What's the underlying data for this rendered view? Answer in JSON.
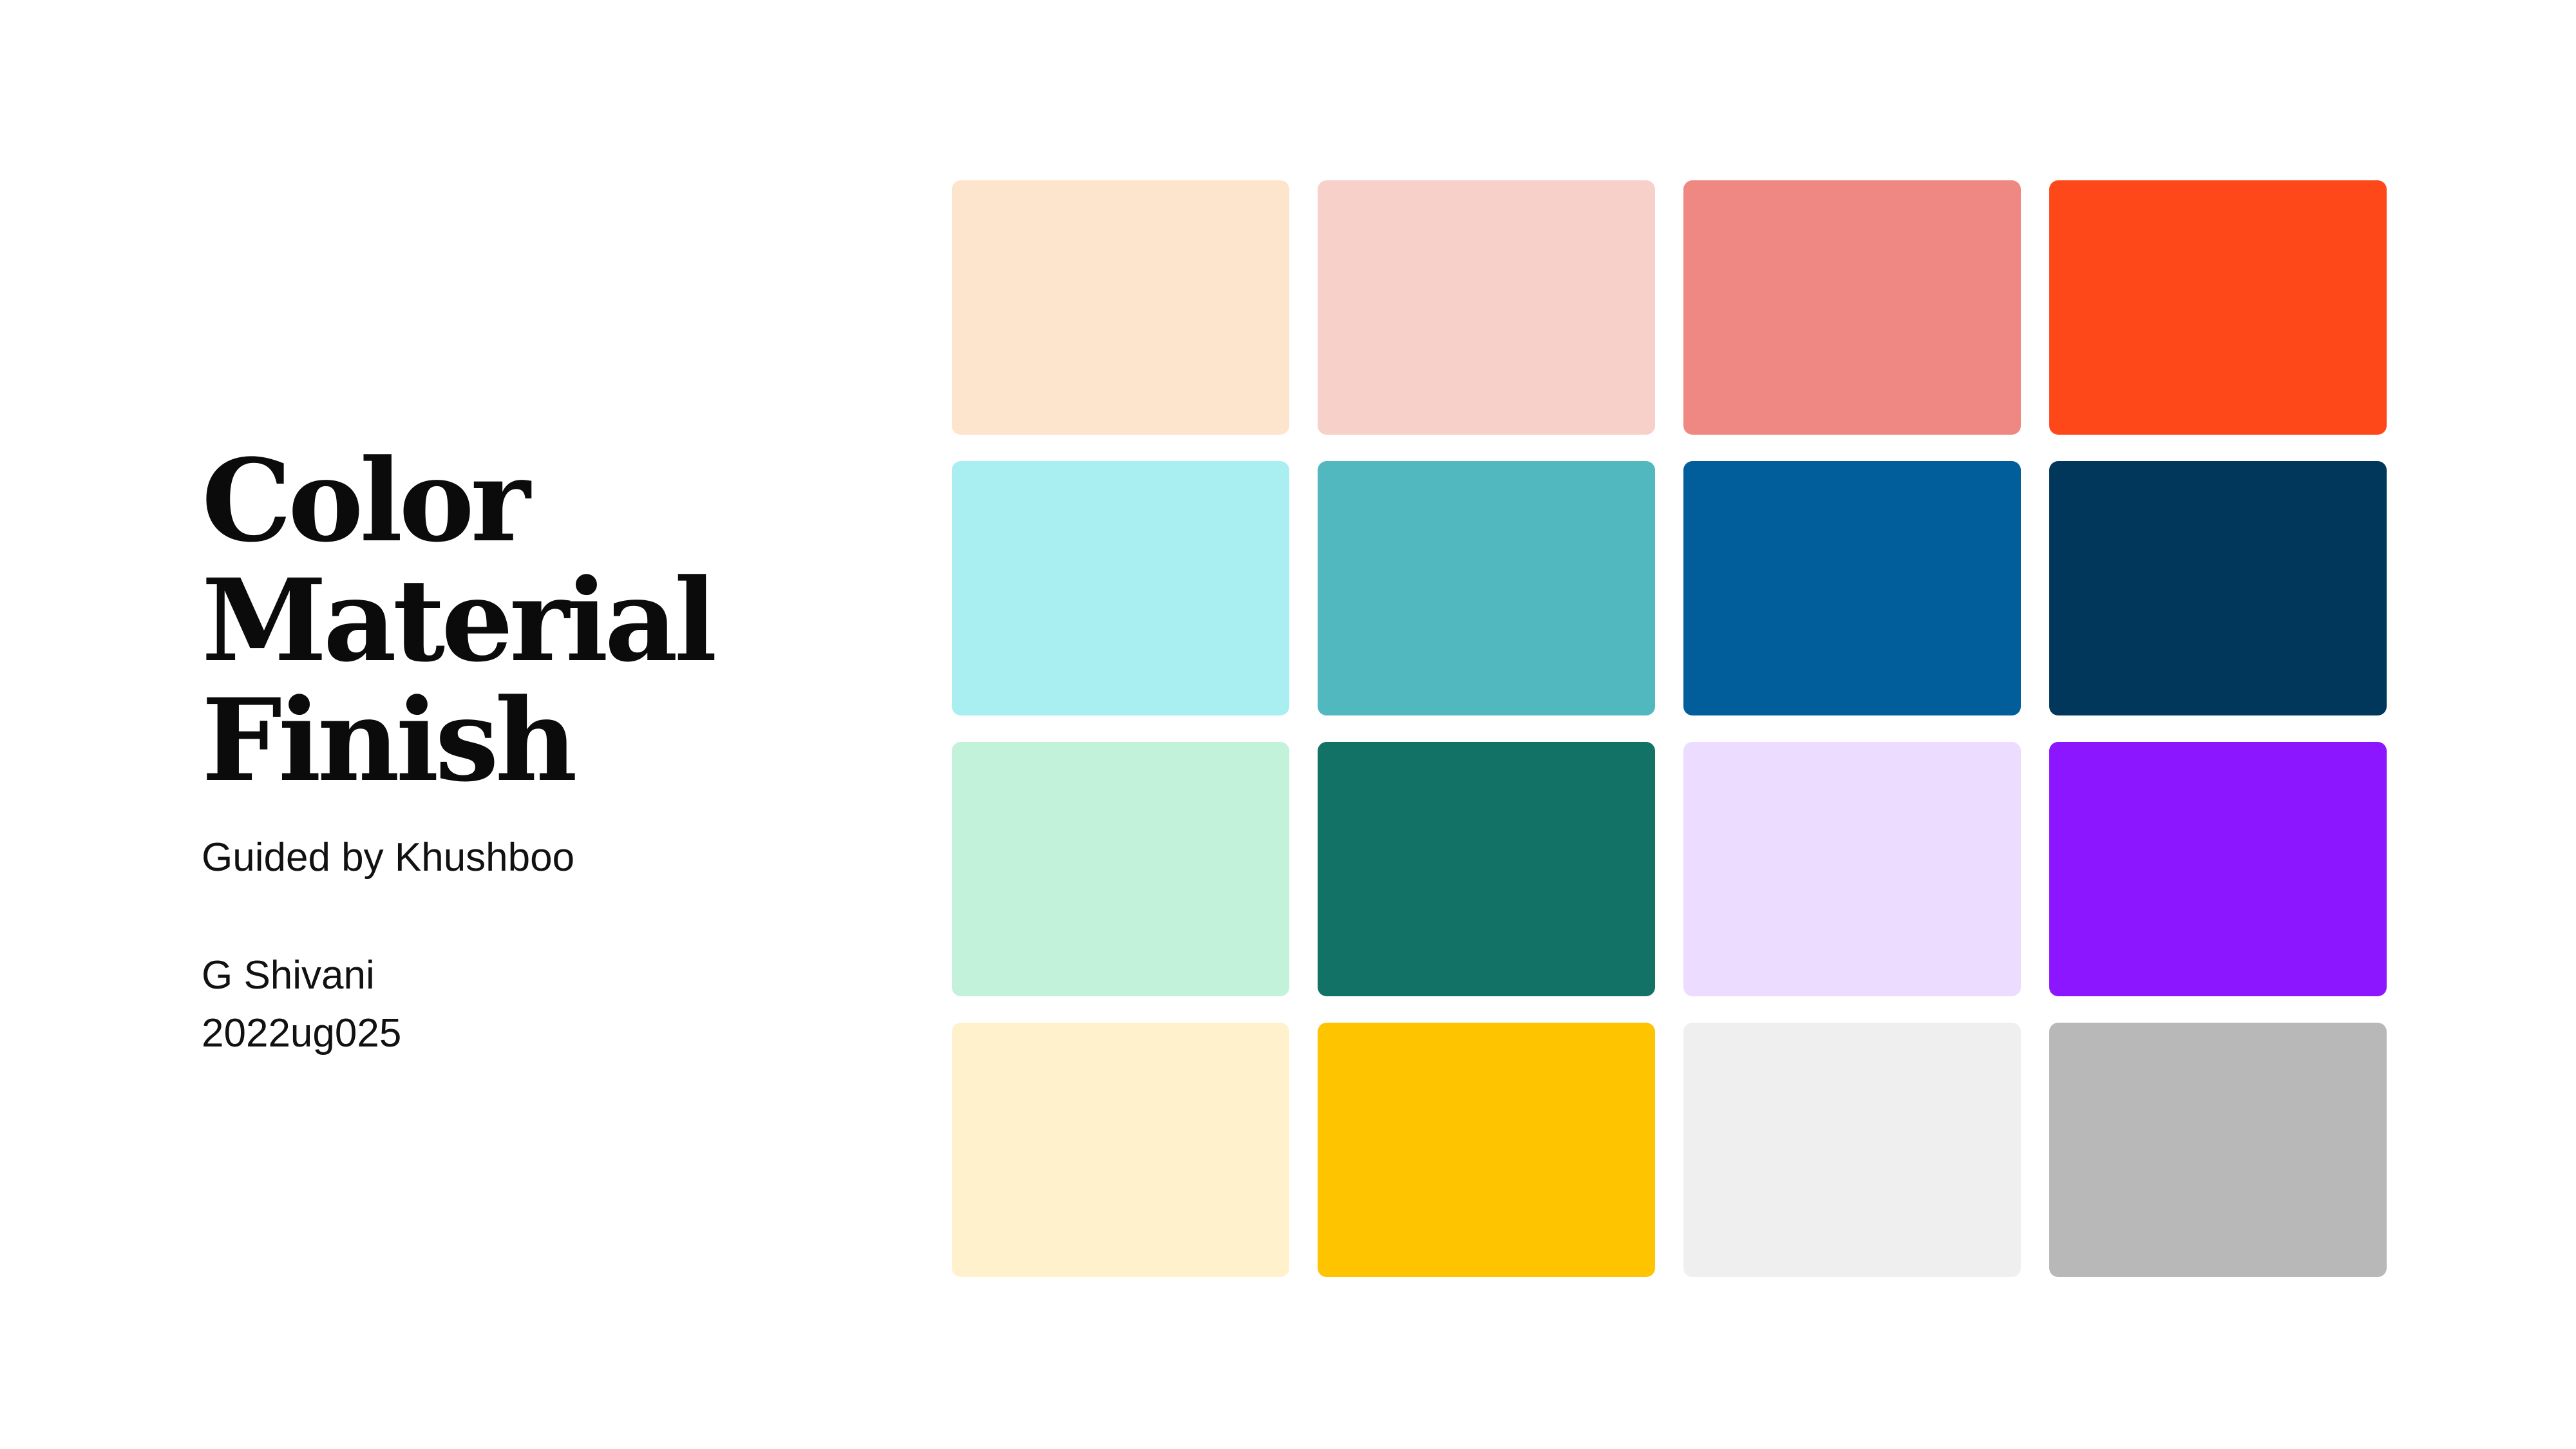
{
  "title": {
    "line1": "Color",
    "line2": "Material",
    "line3": "Finish"
  },
  "subtitle": "Guided by Khushboo",
  "author": {
    "name": "G Shivani",
    "id": "2022ug025"
  },
  "swatches": [
    "#FCE5CC",
    "#F7D0CA",
    "#EF8883",
    "#FF4819",
    "#A9EFF2",
    "#51B8BF",
    "#025E9B",
    "#02375C",
    "#C2F2DA",
    "#137266",
    "#ECDCFF",
    "#8B16FF",
    "#FFF1CC",
    "#FFC400",
    "#EFEFEF",
    "#B8B8B8"
  ]
}
